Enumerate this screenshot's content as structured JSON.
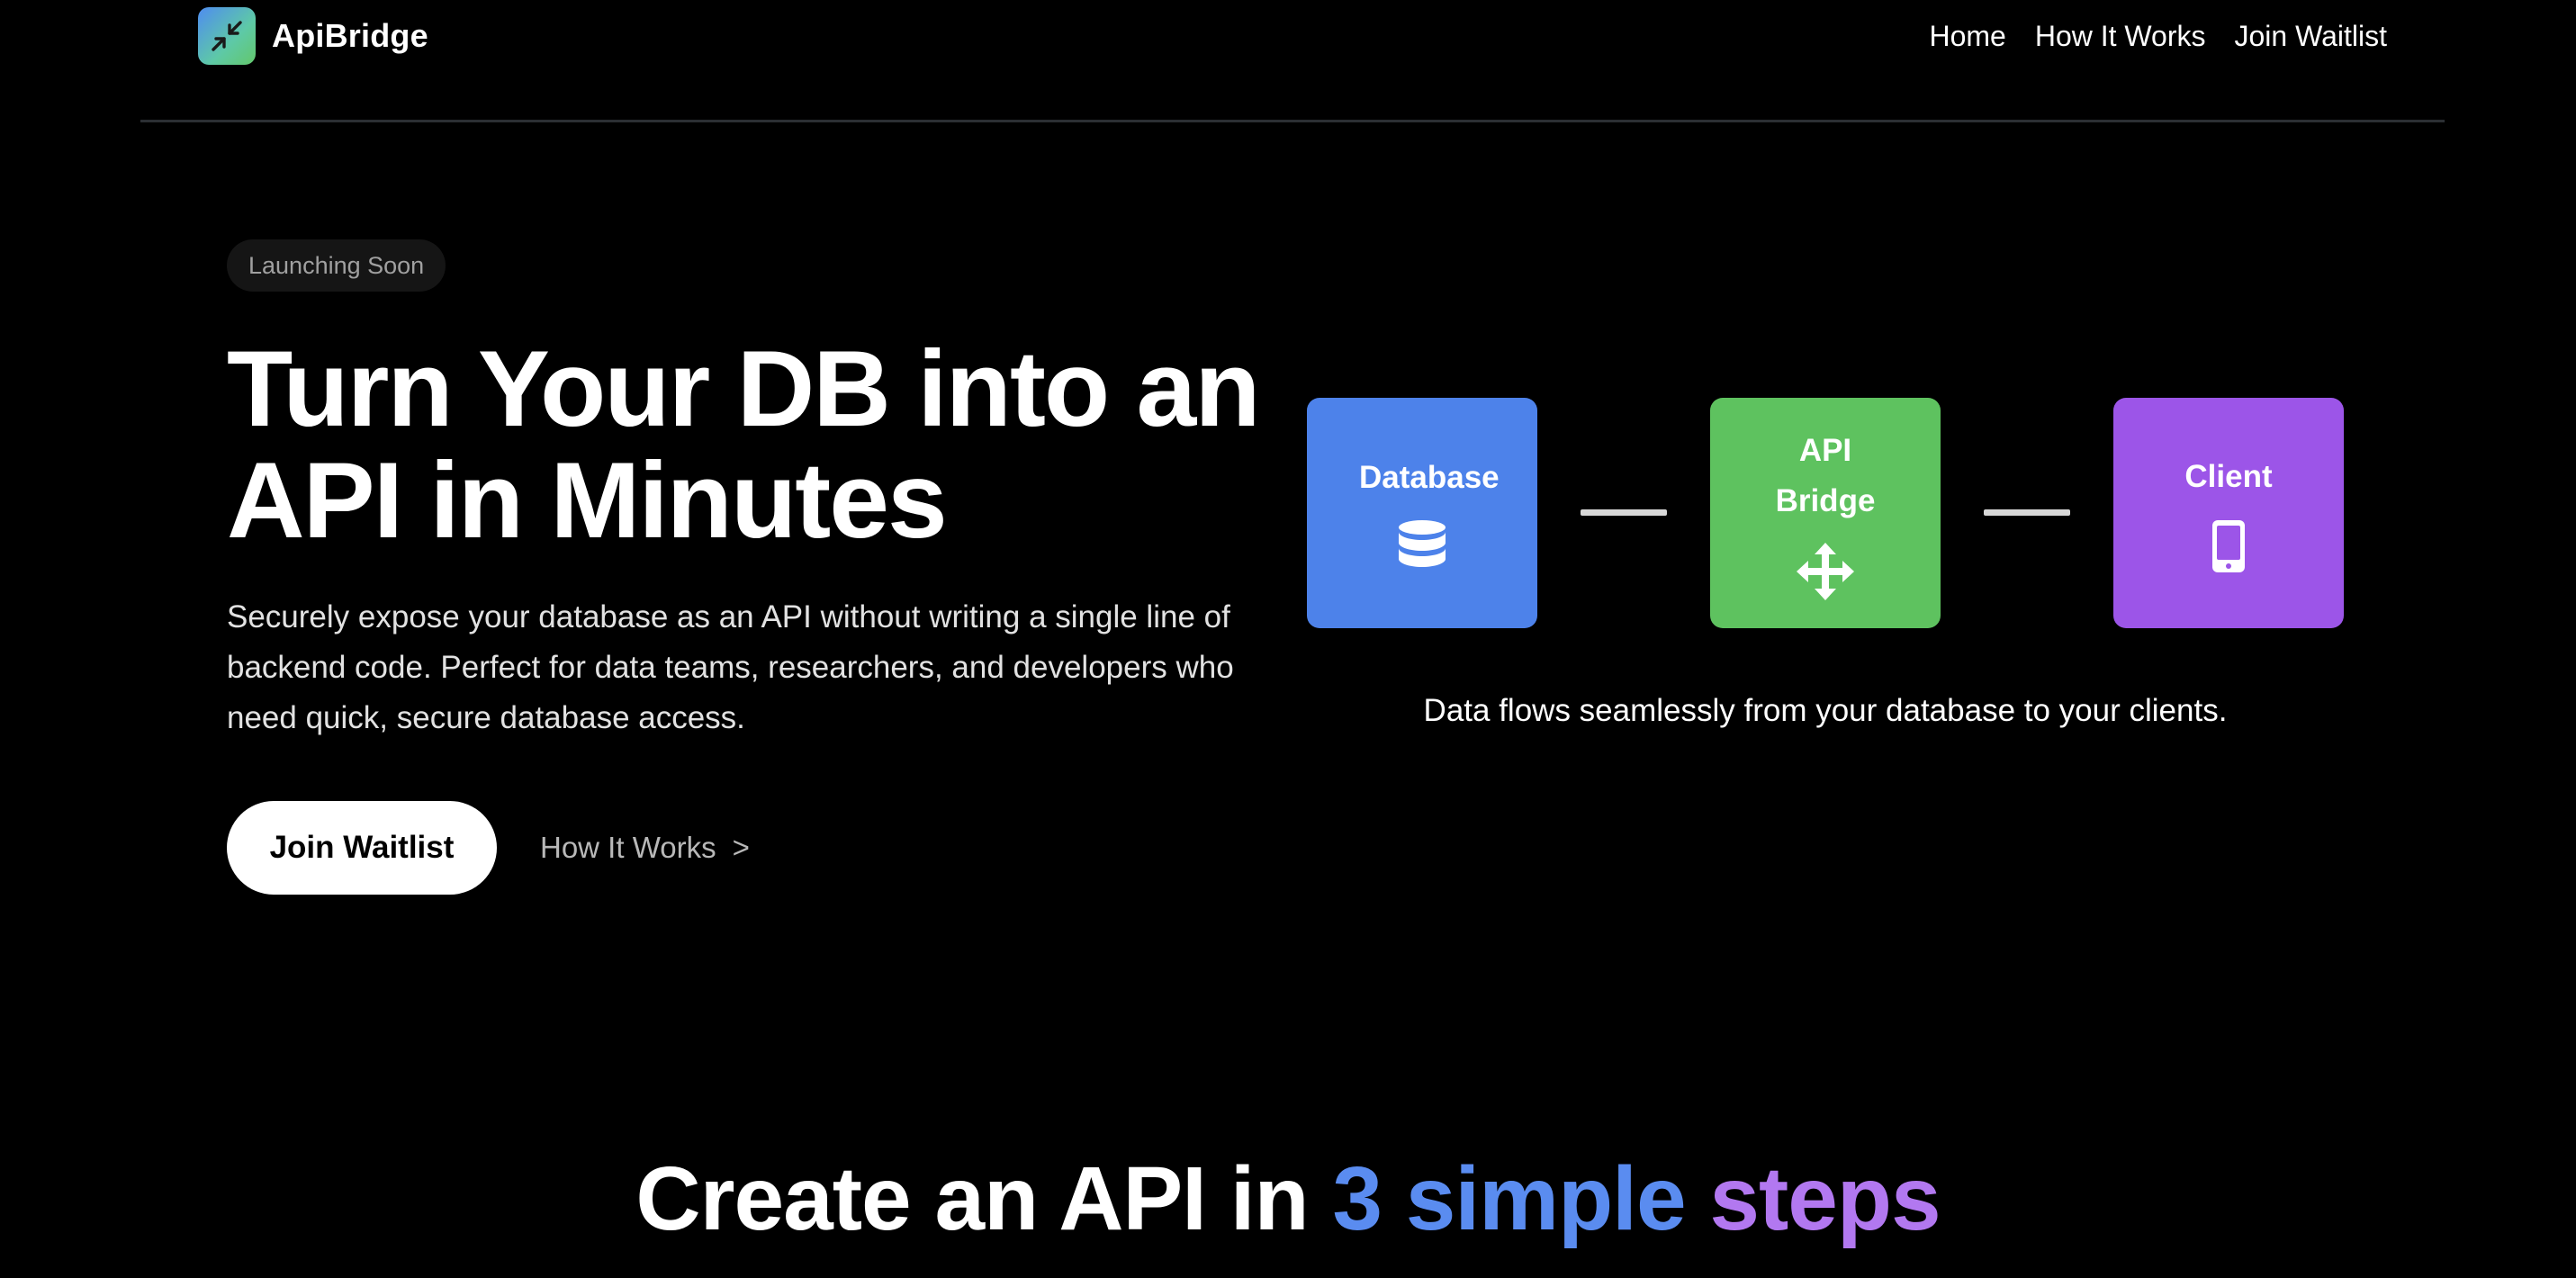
{
  "header": {
    "brand_name": "ApiBridge",
    "logo_icon": "compress-arrows-icon",
    "nav": [
      {
        "label": "Home"
      },
      {
        "label": "How It Works"
      },
      {
        "label": "Join Waitlist"
      }
    ]
  },
  "hero": {
    "badge": "Launching Soon",
    "title_line1": "Turn Your DB into an",
    "title_line2": "API in Minutes",
    "subtitle": "Securely expose your database as an API without writing a single line of backend code. Perfect for data teams, researchers, and developers who need quick, secure database access.",
    "primary_cta": "Join Waitlist",
    "secondary_cta": "How It Works",
    "secondary_cta_chevron": ">"
  },
  "diagram": {
    "nodes": [
      {
        "label": "Database",
        "icon": "database-icon",
        "color": "#4d82ea"
      },
      {
        "label": "API Bridge",
        "icon": "move-arrows-icon",
        "color": "#5ec25f"
      },
      {
        "label": "Client",
        "icon": "mobile-phone-icon",
        "color": "#9c55e8"
      }
    ],
    "caption": "Data flows seamlessly from your database to your clients."
  },
  "steps": {
    "title_prefix": "Create an API in ",
    "title_highlight_1": "3 simple",
    "title_highlight_2": "steps",
    "highlight_colors": [
      "#5a8cf0",
      "#b278f0"
    ]
  },
  "colors": {
    "background": "#000000",
    "divider": "#2b2f33",
    "badge_bg": "#151515"
  }
}
